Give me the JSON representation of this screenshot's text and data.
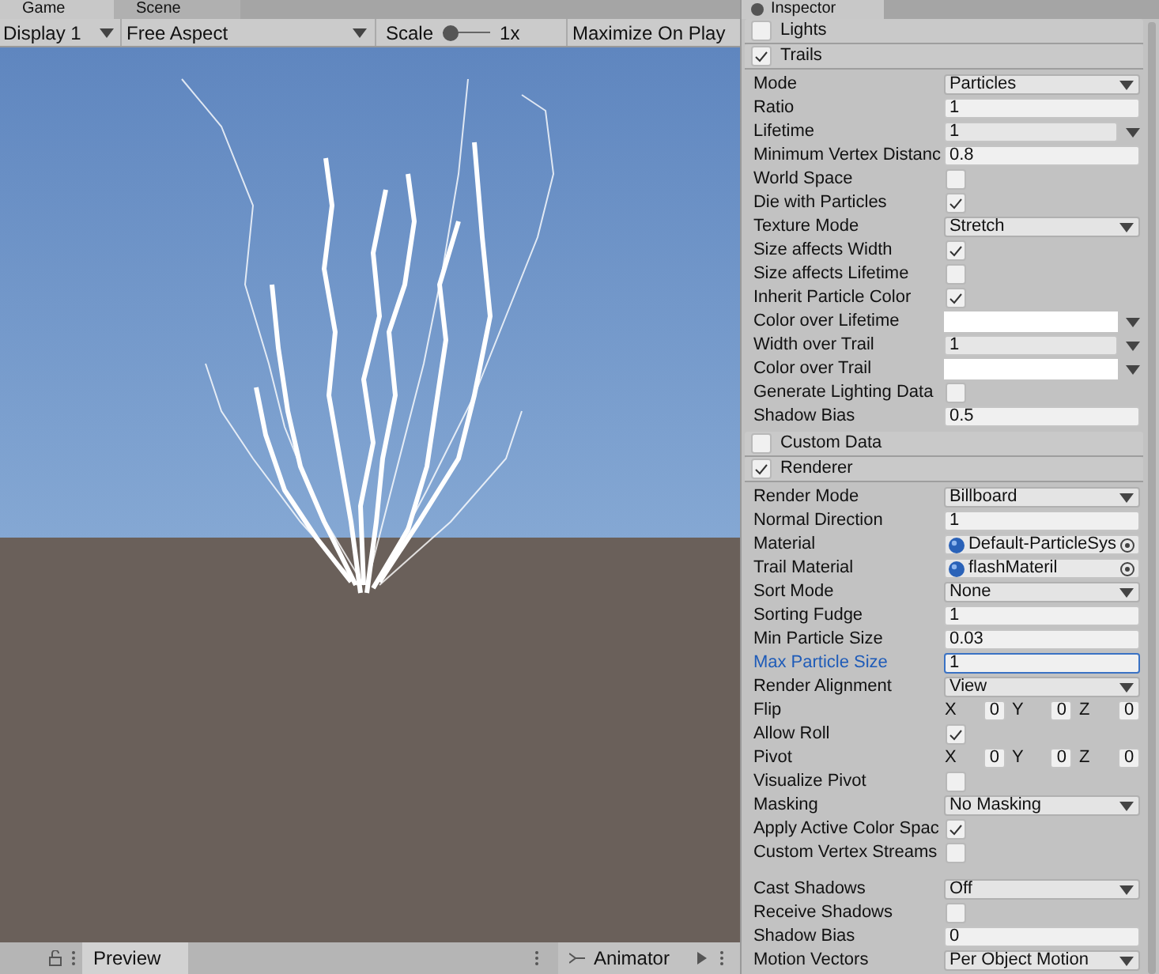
{
  "game_view": {
    "tabs": [
      {
        "label": "Game",
        "selected": true
      },
      {
        "label": "Scene",
        "selected": false
      }
    ],
    "toolbar": {
      "display": "Display 1",
      "aspect": "Free Aspect",
      "scale_label": "Scale",
      "scale": {
        "level": 0,
        "reading": "1x"
      },
      "maximize": "Maximize On Play"
    }
  },
  "inspector": {
    "title": "Inspector",
    "modules": [
      {
        "name": "Lights",
        "enabled": false
      },
      {
        "name": "Trails",
        "enabled": true,
        "rows": [
          {
            "kind": "dropdown",
            "label": "Mode",
            "value": "Particles"
          },
          {
            "kind": "field",
            "label": "Ratio",
            "value": "1",
            "focused": false
          },
          {
            "kind": "curve",
            "label": "Lifetime",
            "value": "1"
          },
          {
            "kind": "field",
            "label": "Minimum Vertex Distanc",
            "value": "0.8",
            "focused": false
          },
          {
            "kind": "checkbox",
            "label": "World Space",
            "checked": false
          },
          {
            "kind": "checkbox",
            "label": "Die with Particles",
            "checked": true
          },
          {
            "kind": "dropdown",
            "label": "Texture Mode",
            "value": "Stretch"
          },
          {
            "kind": "checkbox",
            "label": "Size affects Width",
            "checked": true
          },
          {
            "kind": "checkbox",
            "label": "Size affects Lifetime",
            "checked": false
          },
          {
            "kind": "checkbox",
            "label": "Inherit Particle Color",
            "checked": true
          },
          {
            "kind": "color",
            "label": "Color over Lifetime"
          },
          {
            "kind": "curve",
            "label": "Width over Trail",
            "value": "1"
          },
          {
            "kind": "color",
            "label": "Color over Trail"
          },
          {
            "kind": "checkbox",
            "label": "Generate Lighting Data",
            "checked": false
          },
          {
            "kind": "field",
            "label": "Shadow Bias",
            "value": "0.5",
            "focused": false
          }
        ]
      },
      {
        "name": "Custom Data",
        "enabled": false
      },
      {
        "name": "Renderer",
        "enabled": true,
        "rows": [
          {
            "kind": "dropdown",
            "label": "Render Mode",
            "value": "Billboard"
          },
          {
            "kind": "field",
            "label": "Normal Direction",
            "value": "1",
            "focused": false
          },
          {
            "kind": "object",
            "label": "Material",
            "value": "Default-ParticleSys"
          },
          {
            "kind": "object",
            "label": "Trail Material",
            "value": "flashMateril"
          },
          {
            "kind": "dropdown",
            "label": "Sort Mode",
            "value": "None"
          },
          {
            "kind": "field",
            "label": "Sorting Fudge",
            "value": "1",
            "focused": false
          },
          {
            "kind": "field",
            "label": "Min Particle Size",
            "value": "0.03",
            "focused": false
          },
          {
            "kind": "field",
            "label": "Max Particle Size",
            "value": "1",
            "focused": true
          },
          {
            "kind": "dropdown",
            "label": "Render Alignment",
            "value": "View"
          },
          {
            "kind": "vector",
            "label": "Flip",
            "axes": [
              {
                "axis": "X",
                "value": "0"
              },
              {
                "axis": "Y",
                "value": "0"
              },
              {
                "axis": "Z",
                "value": "0"
              }
            ]
          },
          {
            "kind": "checkbox",
            "label": "Allow Roll",
            "checked": true
          },
          {
            "kind": "vector",
            "label": "Pivot",
            "axes": [
              {
                "axis": "X",
                "value": "0"
              },
              {
                "axis": "Y",
                "value": "0"
              },
              {
                "axis": "Z",
                "value": "0"
              }
            ]
          },
          {
            "kind": "checkbox",
            "label": "Visualize Pivot",
            "checked": false
          },
          {
            "kind": "dropdown",
            "label": "Masking",
            "value": "No Masking"
          },
          {
            "kind": "checkbox",
            "label": "Apply Active Color Spac",
            "checked": true
          },
          {
            "kind": "checkbox",
            "label": "Custom Vertex Streams",
            "checked": false
          },
          {
            "kind": "spacer"
          },
          {
            "kind": "dropdown",
            "label": "Cast Shadows",
            "value": "Off"
          },
          {
            "kind": "checkbox",
            "label": "Receive Shadows",
            "checked": false
          },
          {
            "kind": "field",
            "label": "Shadow Bias",
            "value": "0",
            "focused": false
          },
          {
            "kind": "dropdown",
            "label": "Motion Vectors",
            "value": "Per Object Motion"
          }
        ]
      }
    ]
  },
  "bottom_bar": {
    "tabs": [
      {
        "label": "Preview",
        "selected": true
      },
      {
        "label": "Animator",
        "selected": false
      }
    ]
  }
}
